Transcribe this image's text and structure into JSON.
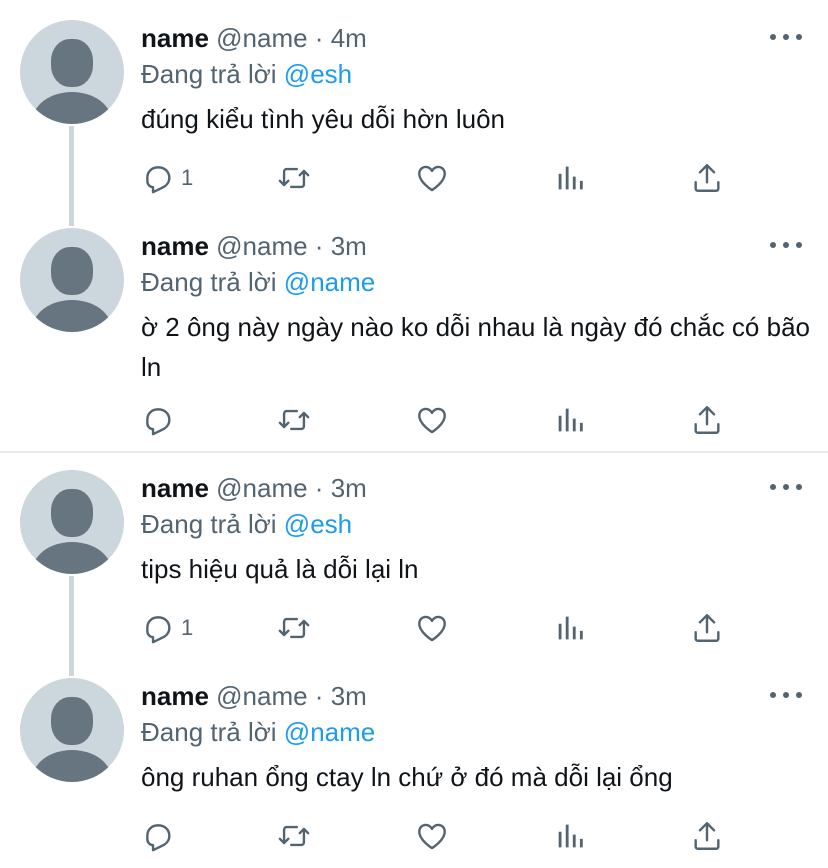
{
  "tweets": [
    {
      "name": "name",
      "meta": "@name · 4m",
      "reply_prefix": "Đang trả lời",
      "reply_to": "@esh",
      "text": "đúng kiểu tình yêu dỗi hờn luôn",
      "reply_count": "1"
    },
    {
      "name": "name",
      "meta": "@name · 3m",
      "reply_prefix": "Đang trả lời",
      "reply_to": "@name",
      "text": "ờ 2 ông này ngày nào ko dỗi nhau là ngày đó chắc có bão ln",
      "reply_count": ""
    },
    {
      "name": "name",
      "meta": "@name · 3m",
      "reply_prefix": "Đang trả lời",
      "reply_to": "@esh",
      "text": "tips hiệu quả là dỗi lại ln",
      "reply_count": "1"
    },
    {
      "name": "name",
      "meta": "@name · 3m",
      "reply_prefix": "Đang trả lời",
      "reply_to": "@name",
      "text": "ông ruhan ổng ctay ln chứ ở đó mà dỗi lại ổng",
      "reply_count": ""
    }
  ],
  "icons": {
    "reply": "reply-icon",
    "retweet": "retweet-icon",
    "like": "heart-icon",
    "views": "analytics-icon",
    "share": "share-icon",
    "more": "more-icon"
  },
  "colors": {
    "accent": "#1d9bf0",
    "icon": "#536471",
    "avatar_bg": "#ccd6dd",
    "avatar_fg": "#66757f"
  }
}
